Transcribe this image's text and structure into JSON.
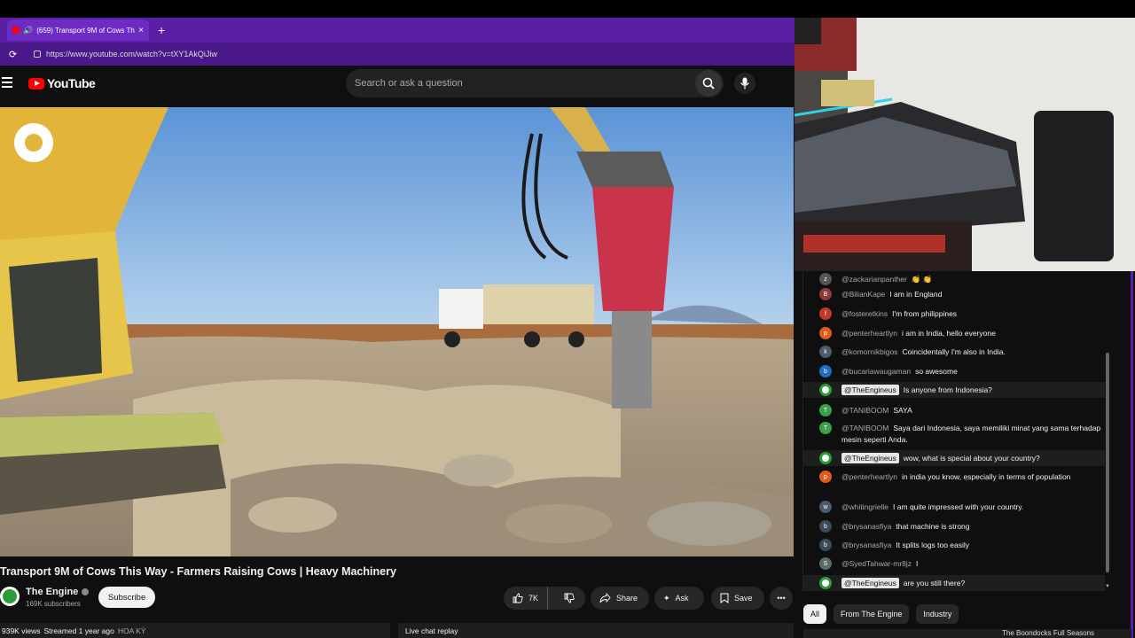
{
  "browser": {
    "tab_title": "(659) Transport 9M of Cows Th",
    "new_tab": "+",
    "close": "×",
    "url": "https://www.youtube.com/watch?v=tXY1AkQiJiw"
  },
  "header": {
    "logo_text": "YouTube",
    "search_placeholder": "Search or ask a question"
  },
  "video": {
    "title": "Transport 9M of Cows This Way - Farmers Raising Cows | Heavy Machinery",
    "channel": "The Engine",
    "subscribers": "169K subscribers",
    "subscribe_label": "Subscribe",
    "likes": "7K",
    "share_label": "Share",
    "ask_label": "Ask",
    "save_label": "Save",
    "views": "939K views",
    "streamed": "Streamed 1 year ago",
    "location": "HOA KỲ",
    "live_chat_replay": "Live chat replay"
  },
  "chat": {
    "messages": [
      {
        "avatar": "z",
        "color": "#555555",
        "author": "@zackarianpanther",
        "text": "👏 👏",
        "owner": false
      },
      {
        "avatar": "B",
        "color": "#8d3b3b",
        "author": "@BilianKape",
        "text": "I am in England",
        "owner": false
      },
      {
        "avatar": "f",
        "color": "#c0392b",
        "author": "@fosteretkins",
        "text": "I'm from philippines",
        "owner": false
      },
      {
        "avatar": "p",
        "color": "#e05a1a",
        "author": "@penterheartlyn",
        "text": "i am in India, hello everyone",
        "owner": false
      },
      {
        "avatar": "k",
        "color": "#4a5a6a",
        "author": "@komornikbigos",
        "text": "Coincidentally I'm also in India.",
        "owner": false
      },
      {
        "avatar": "b",
        "color": "#1e6fc0",
        "author": "@bucariawaugaman",
        "text": "so awesome",
        "owner": false
      },
      {
        "avatar": "",
        "color": "#2a9d3a",
        "author": "@TheEngineus",
        "text": "Is anyone from Indonesia?",
        "owner": true
      },
      {
        "avatar": "T",
        "color": "#3aa04a",
        "author": "@TANIBOOM",
        "text": "SAYA",
        "owner": false
      },
      {
        "avatar": "T",
        "color": "#3aa04a",
        "author": "@TANIBOOM",
        "text": "Saya dari Indonesia, saya memiliki minat yang sama terhadap mesin seperti Anda.",
        "owner": false
      },
      {
        "avatar": "",
        "color": "#2a9d3a",
        "author": "@TheEngineus",
        "text": "wow, what is special about your country?",
        "owner": true
      },
      {
        "avatar": "p",
        "color": "#e05a1a",
        "author": "@penterheartlyn",
        "text": "in india you know, especially in terms of population",
        "owner": false
      },
      {
        "avatar": "w",
        "color": "#4a5a6a",
        "author": "@whitingrielle",
        "text": "I am quite impressed with your country.",
        "owner": false
      },
      {
        "avatar": "b",
        "color": "#3a4a5a",
        "author": "@brysanasfiya",
        "text": "that machine is strong",
        "owner": false
      },
      {
        "avatar": "b",
        "color": "#3a4a5a",
        "author": "@brysanasfiya",
        "text": "It splits logs too easily",
        "owner": false
      },
      {
        "avatar": "S",
        "color": "#5a6a6a",
        "author": "@SyedTahwar-mr8jz",
        "text": "I",
        "owner": false
      },
      {
        "avatar": "",
        "color": "#2a9d3a",
        "author": "@TheEngineus",
        "text": "are you still there?",
        "owner": true
      }
    ],
    "chips": [
      "All",
      "From The Engine",
      "Industry"
    ],
    "bottom_text": "The Boondocks Full Seasons"
  },
  "colors": {
    "browser_accent": "#5b1fa6",
    "youtube_red": "#ff0000",
    "background": "#0f0f0f"
  },
  "icons": [
    "hamburger-icon",
    "search-icon",
    "mic-icon",
    "like-icon",
    "dislike-icon",
    "share-icon",
    "ask-icon",
    "save-icon",
    "more-icon",
    "reload-icon",
    "speaker-icon",
    "settings-gear-icon"
  ]
}
